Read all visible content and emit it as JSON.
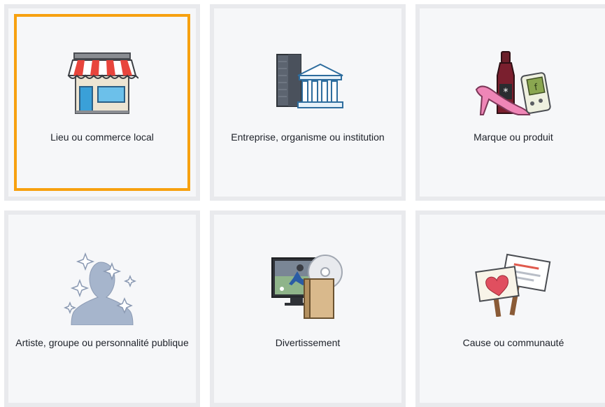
{
  "categories": [
    {
      "label": "Lieu ou commerce local",
      "icon": "storefront-icon",
      "selected": true
    },
    {
      "label": "Entreprise, organisme ou institution",
      "icon": "institution-buildings-icon",
      "selected": false
    },
    {
      "label": "Marque ou produit",
      "icon": "brand-products-icon",
      "selected": false
    },
    {
      "label": "Artiste, groupe ou personnalité publique",
      "icon": "public-figure-icon",
      "selected": false
    },
    {
      "label": "Divertissement",
      "icon": "entertainment-icon",
      "selected": false
    },
    {
      "label": "Cause ou communauté",
      "icon": "cause-signs-icon",
      "selected": false
    }
  ],
  "colors": {
    "selection_border": "#f7a110",
    "tile_background": "#f6f7f9",
    "tile_border": "#e9eaed",
    "text": "#1d2129"
  }
}
